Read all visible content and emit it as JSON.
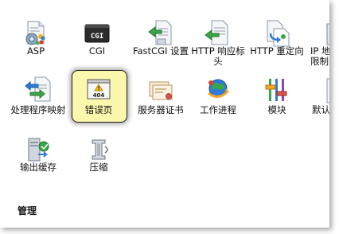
{
  "icons": {
    "asp": "ASP",
    "cgi": "CGI",
    "fastcgi": "FastCGI 设置",
    "http_response_headers": "HTTP 响应标头",
    "http_redirect": "HTTP 重定向",
    "ip_restrictions": "IP 地址和域限制",
    "handler_mappings": "处理程序映射",
    "error_pages": "错误页",
    "server_certificates": "服务器证书",
    "worker_processes": "工作进程",
    "modules": "模块",
    "default_document": "默认文档",
    "output_caching": "输出缓存",
    "compression": "压缩"
  },
  "cgi_icon_text": "CGI",
  "error_icon_text": "404",
  "section": {
    "management": "管理"
  },
  "colors": {
    "selection_bg": "#fbf7ac",
    "selection_border": "#1f1f1f",
    "accent_blue": "#2f7bd6",
    "accent_green": "#3aa64a"
  }
}
